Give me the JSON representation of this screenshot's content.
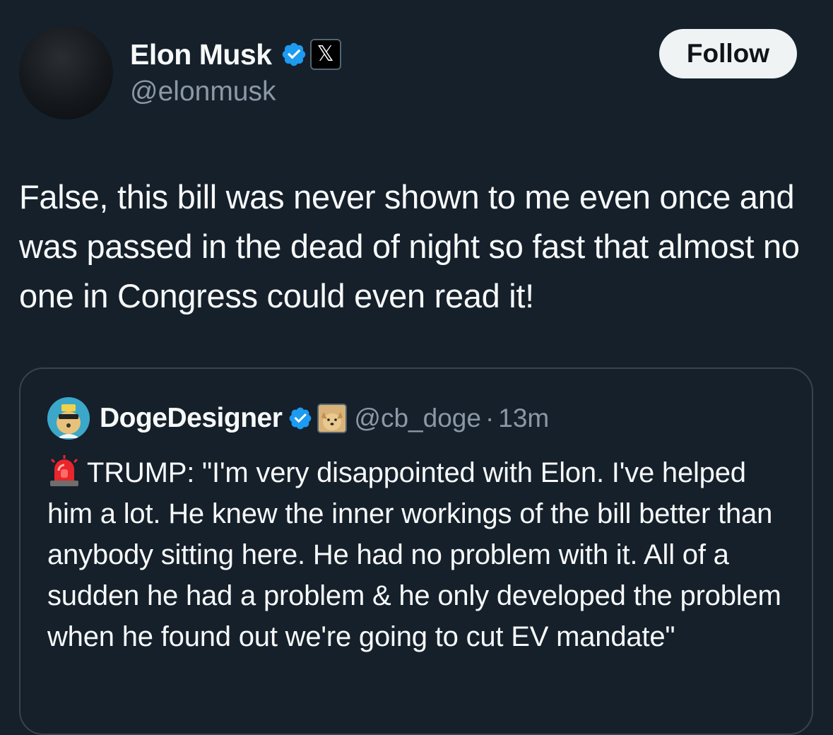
{
  "author": {
    "display_name": "Elon Musk",
    "handle": "@elonmusk",
    "verified_icon": "verified-badge-icon",
    "affiliation_icon": "x-logo-icon",
    "affiliation_glyph": "𝕏"
  },
  "follow_button": {
    "label": "Follow"
  },
  "tweet": {
    "text": "False, this bill was never shown to me even once and was passed in the dead of night so fast that almost no one in Congress could even read it!"
  },
  "quoted_tweet": {
    "display_name": "DogeDesigner",
    "handle": "@cb_doge",
    "separator": "·",
    "time": "13m",
    "text": "TRUMP: \"I'm very disappointed with Elon. I've helped him a lot. He knew the inner workings of the bill better than anybody sitting here. He had no problem with it. All of a sudden he had a problem & he only developed the problem when he found out we're going to cut EV mandate\"",
    "leading_emoji_icon": "rotating-light-icon"
  },
  "colors": {
    "background": "#15202b",
    "text": "#f7f9f9",
    "secondary_text": "#8b98a5",
    "border": "#38444d",
    "verified_blue": "#1d9bf0",
    "follow_bg": "#eff3f4"
  }
}
